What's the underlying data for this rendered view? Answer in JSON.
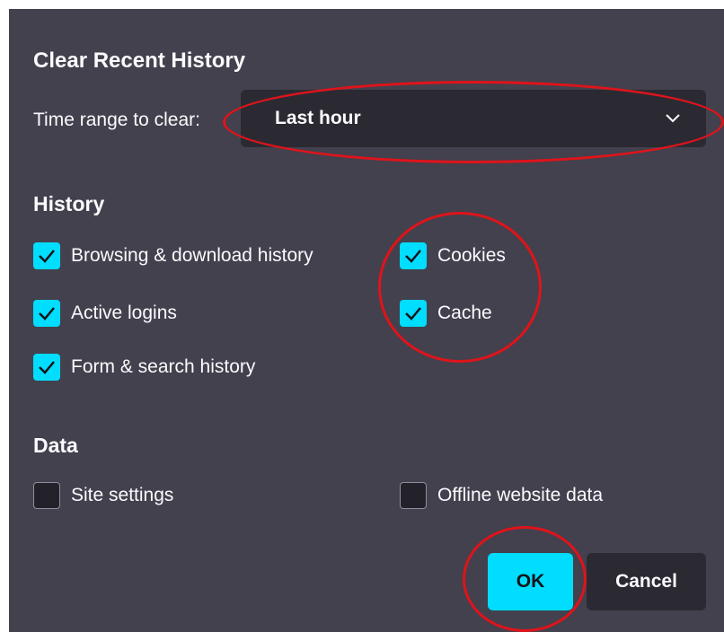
{
  "dialog": {
    "title": "Clear Recent History",
    "time_range_label": "Time range to clear:",
    "time_range_value": "Last hour"
  },
  "history": {
    "heading": "History",
    "items": [
      {
        "label": "Browsing & download history",
        "checked": true
      },
      {
        "label": "Active logins",
        "checked": true
      },
      {
        "label": "Form & search history",
        "checked": true
      },
      {
        "label": "Cookies",
        "checked": true
      },
      {
        "label": "Cache",
        "checked": true
      }
    ]
  },
  "data": {
    "heading": "Data",
    "items": [
      {
        "label": "Site settings",
        "checked": false
      },
      {
        "label": "Offline website data",
        "checked": false
      }
    ]
  },
  "buttons": {
    "ok": "OK",
    "cancel": "Cancel"
  },
  "colors": {
    "dialog_bg": "#42414d",
    "accent": "#00ddff",
    "annotation": "#e0131a"
  }
}
